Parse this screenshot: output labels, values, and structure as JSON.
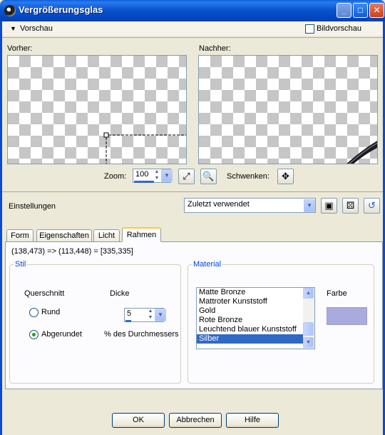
{
  "window": {
    "title": "Vergrößerungsglas",
    "controls": {
      "minimize": "_",
      "maximize": "□",
      "close": "✕"
    }
  },
  "preview": {
    "toggle_label": "Vorschau",
    "bildvorschau_label": "Bildvorschau",
    "bildvorschau_checked": false,
    "before_label": "Vorher:",
    "after_label": "Nachher:",
    "zoom_label": "Zoom:",
    "zoom_value": "100",
    "pan_label": "Schwenken:"
  },
  "settings": {
    "label": "Einstellungen",
    "preset_value": "Zuletzt verwendet"
  },
  "tabs": [
    {
      "label": "Form"
    },
    {
      "label": "Eigenschaften"
    },
    {
      "label": "Licht"
    },
    {
      "label": "Rahmen",
      "active": true
    }
  ],
  "coords_text": "(138,473) => (113,448) = [335,335]",
  "stil": {
    "title": "Stil",
    "querschnitt_label": "Querschnitt",
    "dicke_label": "Dicke",
    "options": [
      {
        "label": "Rund",
        "selected": false
      },
      {
        "label": "Abgerundet",
        "selected": true
      }
    ],
    "dicke_value": "5",
    "dicke_unit": "% des Durchmessers"
  },
  "material": {
    "title": "Material",
    "items": [
      "Matte Bronze",
      "Mattroter Kunststoff",
      "Gold",
      "Rote Bronze",
      "Leuchtend blauer Kunststoff",
      "Silber"
    ],
    "selected": "Silber",
    "color_label": "Farbe",
    "color_swatch": "#a9abdf"
  },
  "buttons": {
    "ok": "OK",
    "cancel": "Abbrechen",
    "help": "Hilfe"
  },
  "colors": {
    "titlebar": "#0a55d0",
    "selection": "#316ac5",
    "groupbox_title": "#0046d5"
  }
}
